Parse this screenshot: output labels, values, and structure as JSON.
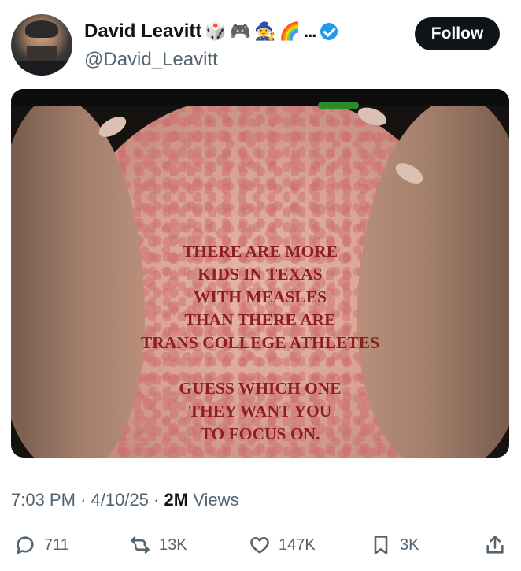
{
  "author": {
    "display_name": "David Leavitt",
    "badges": [
      "🎲",
      "🎮",
      "🧙",
      "🌈"
    ],
    "ellipsis": "...",
    "handle": "@David_Leavitt",
    "verified": true,
    "accent_color": "#1d9bf0"
  },
  "follow_button": {
    "label": "Follow"
  },
  "media": {
    "text_block_1": [
      "THERE ARE MORE",
      "KIDS IN TEXAS",
      "WITH MEASLES",
      "THAN THERE ARE",
      "TRANS COLLEGE ATHLETES"
    ],
    "text_block_2": [
      "GUESS WHICH ONE",
      "THEY WANT YOU",
      "TO FOCUS ON."
    ],
    "text_color": "#8e1d1f"
  },
  "meta": {
    "time": "7:03 PM",
    "sep1": "·",
    "date": "4/10/25",
    "sep2": "·",
    "views_count": "2M",
    "views_label": "Views"
  },
  "actions": {
    "replies": {
      "icon": "reply-icon",
      "count": "711"
    },
    "reposts": {
      "icon": "repost-icon",
      "count": "13K"
    },
    "likes": {
      "icon": "heart-icon",
      "count": "147K"
    },
    "bookmarks": {
      "icon": "bookmark-icon",
      "count": "3K"
    },
    "share": {
      "icon": "share-icon"
    }
  }
}
